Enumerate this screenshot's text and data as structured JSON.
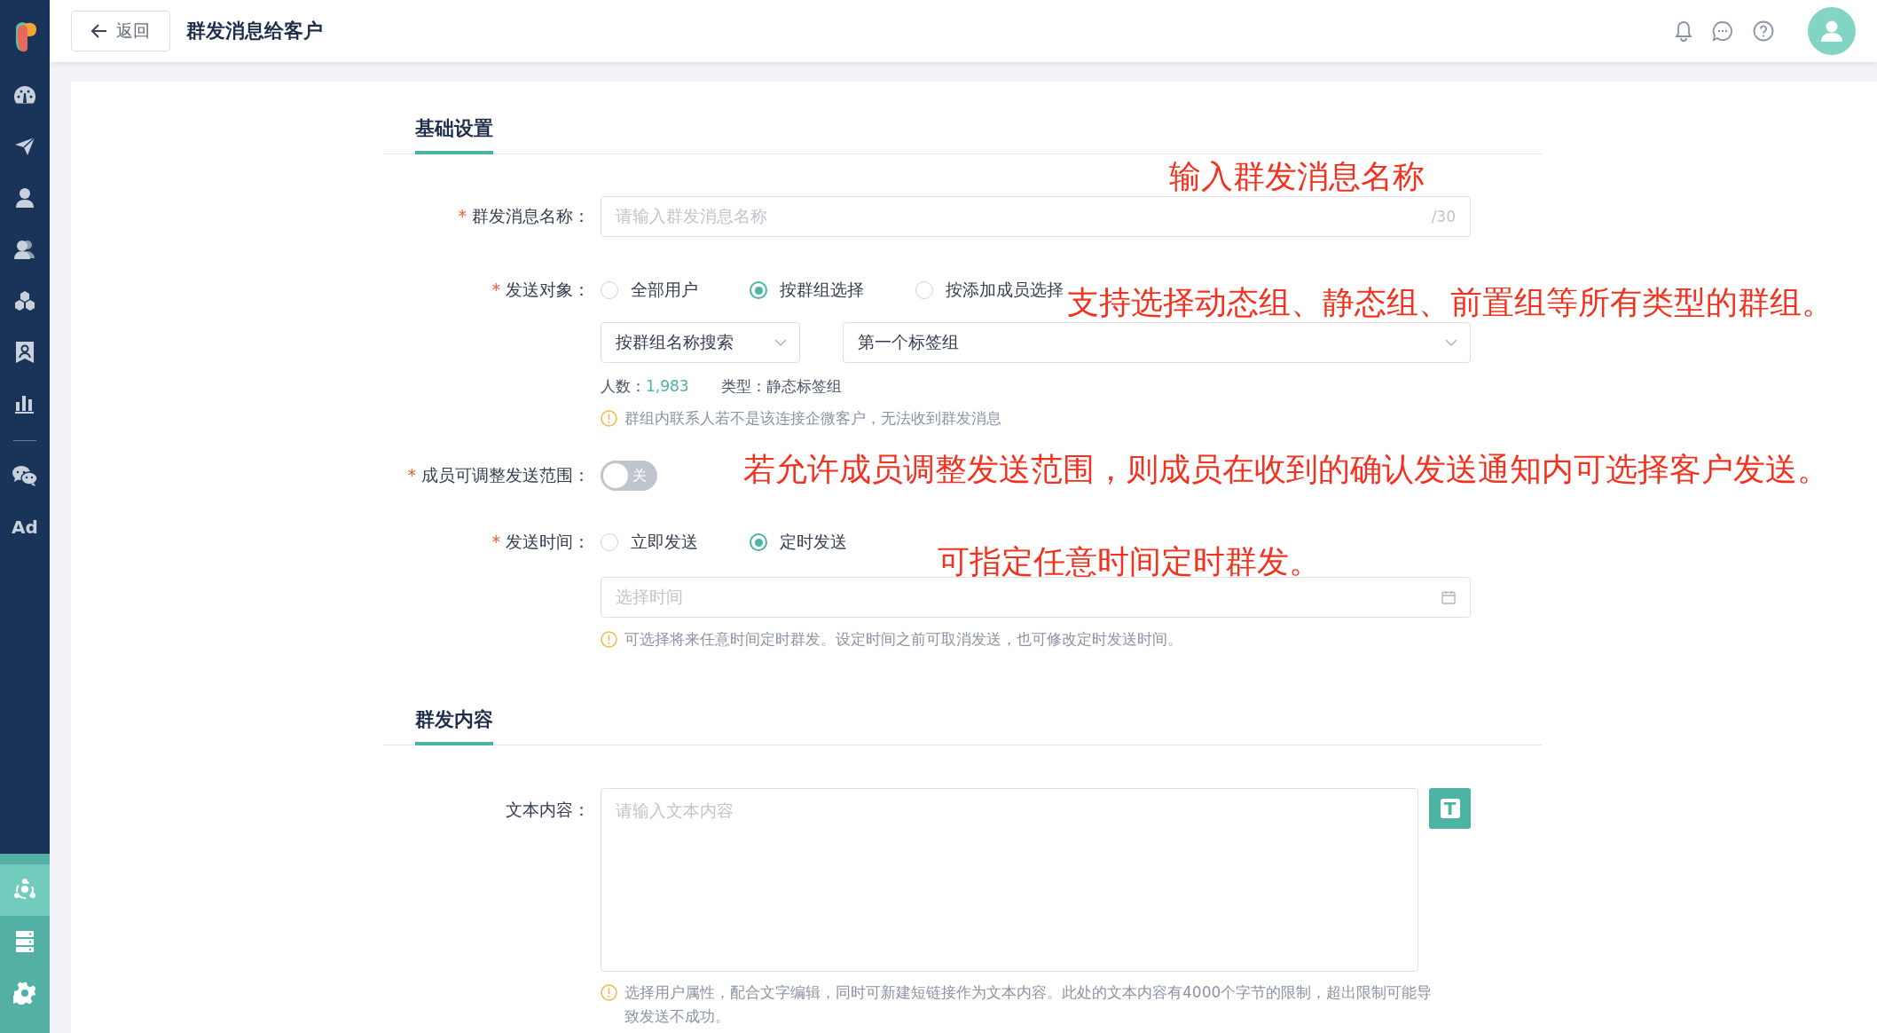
{
  "sidebar": {
    "top_items": [
      {
        "selected": false
      },
      {
        "selected": false
      },
      {
        "selected": false
      },
      {
        "selected": false
      },
      {
        "selected": false
      },
      {
        "selected": false
      },
      {
        "selected": false
      },
      {
        "selected": false
      },
      {
        "label": "Ad",
        "selected": false
      }
    ],
    "bottom_items": [
      {
        "selected": true
      },
      {
        "selected": false
      },
      {
        "selected": false
      }
    ]
  },
  "header": {
    "back_button": "返回",
    "title": "群发消息给客户"
  },
  "basic": {
    "title": "基础设置",
    "name_field": {
      "required_mark": "*",
      "label": "群发消息名称：",
      "placeholder": "请输入群发消息名称",
      "counter": "/30"
    },
    "target": {
      "required_mark": "*",
      "label": "发送对象：",
      "options": [
        {
          "label": "全部用户",
          "selected": false
        },
        {
          "label": "按群组选择",
          "selected": true
        },
        {
          "label": "按添加成员选择",
          "selected": false
        }
      ]
    },
    "group_search": {
      "value": "按群组名称搜索"
    },
    "group_select": {
      "value": "第一个标签组"
    },
    "count_label": "人数：",
    "count": "1,983",
    "type_label": "类型：",
    "type": "静态标签组",
    "group_note": "群组内联系人若不是该连接企微客户，无法收到群发消息",
    "adjust": {
      "required_mark": "*",
      "label": "成员可调整发送范围：",
      "on": false,
      "state_text": "关"
    },
    "time": {
      "required_mark": "*",
      "label": "发送时间：",
      "options": [
        {
          "label": "立即发送",
          "selected": false
        },
        {
          "label": "定时发送",
          "selected": true
        }
      ]
    },
    "time_field": {
      "placeholder": "选择时间"
    },
    "time_note": "可选择将来任意时间定时群发。设定时间之前可取消发送，也可修改定时发送时间。"
  },
  "content": {
    "title": "群发内容",
    "text_field": {
      "label": "文本内容：",
      "placeholder": "请输入文本内容"
    },
    "text_button": "T",
    "note": "选择用户属性，配合文字编辑，同时可新建短链接作为文本内容。此处的文本内容有4000个字节的限制，超出限制可能导致发送不成功。"
  },
  "annotations": [
    "输入群发消息名称",
    "支持选择动态组、静态组、前置组等所有类型的群组。",
    "若允许成员调整发送范围，则成员在收到的确认发送通知内可选择客户发送。",
    "可指定任意时间定时群发。"
  ]
}
